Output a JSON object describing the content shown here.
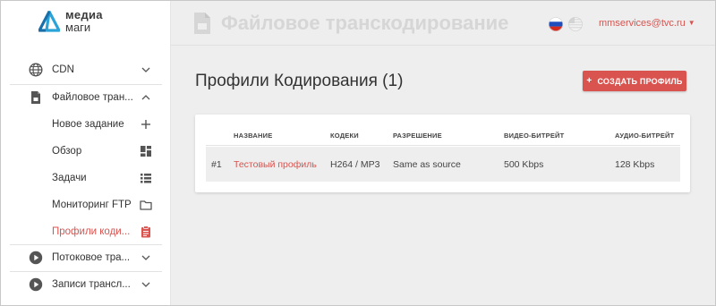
{
  "brand": {
    "line1": "медиа",
    "line2": "маги"
  },
  "header": {
    "title": "Файловое транскодирование",
    "user_email": "mmservices@tvc.ru"
  },
  "sidebar": {
    "items": [
      {
        "label": "CDN",
        "icon": "globe-icon"
      },
      {
        "label": "Файловое тран...",
        "icon": "file-icon"
      },
      {
        "label": "Новое задание",
        "icon": "plus-icon"
      },
      {
        "label": "Обзор",
        "icon": "dashboard-icon"
      },
      {
        "label": "Задачи",
        "icon": "list-icon"
      },
      {
        "label": "Мониторинг FTP",
        "icon": "folder-icon"
      },
      {
        "label": "Профили коди...",
        "icon": "clipboard-icon"
      },
      {
        "label": "Потоковое тра...",
        "icon": "play-circle-icon"
      },
      {
        "label": "Записи трансл...",
        "icon": "play-circle-icon"
      }
    ]
  },
  "main": {
    "title": "Профили Кодирования (1)",
    "create_button": {
      "plus": "+",
      "label": "СОЗДАТЬ ПРОФИЛЬ"
    },
    "table": {
      "columns": [
        "НАЗВАНИЕ",
        "КОДЕКИ",
        "РАЗРЕШЕНИЕ",
        "ВИДЕО-БИТРЕЙТ",
        "АУДИО-БИТРЕЙТ"
      ],
      "rows": [
        {
          "num": "#1",
          "name": "Тестовый профиль",
          "codecs": "H264 / MP3",
          "resolution": "Same as source",
          "video_bitrate": "500 Kbps",
          "audio_bitrate": "128 Kbps"
        }
      ]
    }
  },
  "colors": {
    "accent": "#d9534f",
    "logo": "#29a3d8",
    "background": "#eeeeee"
  }
}
